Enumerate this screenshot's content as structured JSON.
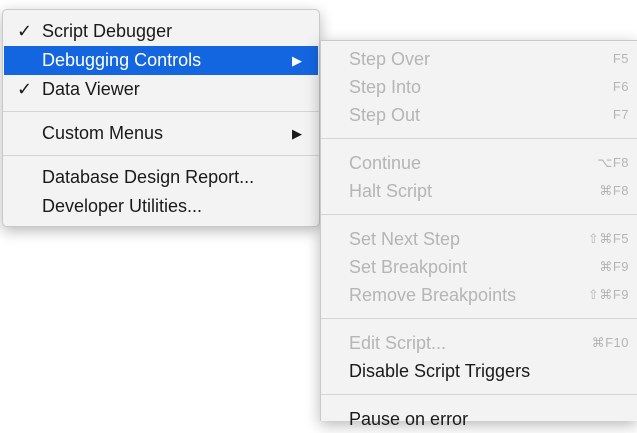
{
  "main_menu": {
    "items": [
      {
        "label": "Script Debugger",
        "check": "✓"
      },
      {
        "label": "Debugging Controls",
        "arrow": "▶"
      },
      {
        "label": "Data Viewer",
        "check": "✓"
      },
      {
        "label": "Custom Menus",
        "arrow": "▶"
      },
      {
        "label": "Database Design Report..."
      },
      {
        "label": "Developer Utilities..."
      }
    ]
  },
  "submenu": {
    "items": [
      {
        "label": "Step Over",
        "shortcut": "F5"
      },
      {
        "label": "Step Into",
        "shortcut": "F6"
      },
      {
        "label": "Step Out",
        "shortcut": "F7"
      },
      {
        "label": "Continue",
        "shortcut": "⌥F8"
      },
      {
        "label": "Halt Script",
        "shortcut": "⌘F8"
      },
      {
        "label": "Set Next Step",
        "shortcut": "⇧⌘F5"
      },
      {
        "label": "Set Breakpoint",
        "shortcut": "⌘F9"
      },
      {
        "label": "Remove Breakpoints",
        "shortcut": "⇧⌘F9"
      },
      {
        "label": "Edit Script...",
        "shortcut": "⌘F10"
      },
      {
        "label": "Disable Script Triggers"
      },
      {
        "label": "Pause on error"
      }
    ]
  },
  "colors": {
    "highlight": "#1466e0",
    "disabled_text": "#b5b5b5",
    "menu_bg": "#f3f3f3"
  }
}
